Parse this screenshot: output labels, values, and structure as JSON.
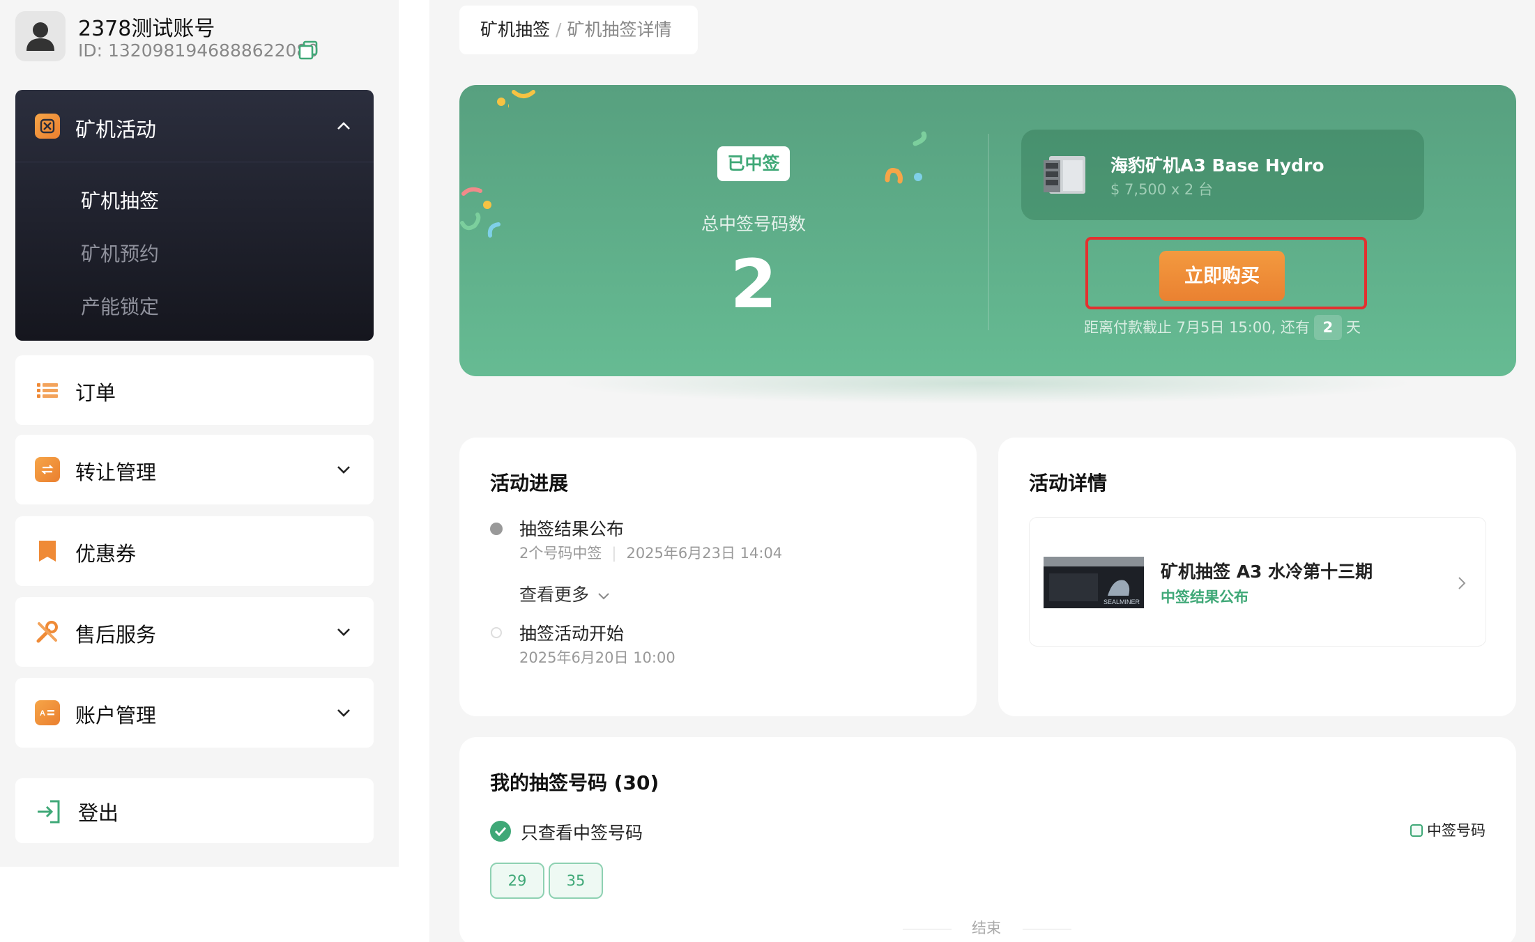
{
  "user": {
    "name": "2378测试账号",
    "id_text": "ID: 1320981946888622080"
  },
  "sidebar": {
    "groups": [
      {
        "label": "矿机活动",
        "expanded": true,
        "icon": "miner-activity-icon",
        "children": [
          {
            "label": "矿机抽签",
            "active": true
          },
          {
            "label": "矿机预约",
            "active": false
          },
          {
            "label": "产能锁定",
            "active": false
          }
        ]
      },
      {
        "label": "订单",
        "icon": "list-icon"
      },
      {
        "label": "转让管理",
        "icon": "transfer-icon"
      },
      {
        "label": "优惠券",
        "icon": "bookmark-icon"
      },
      {
        "label": "售后服务",
        "icon": "wrench-icon"
      },
      {
        "label": "账户管理",
        "icon": "id-card-icon"
      }
    ],
    "logout_label": "登出"
  },
  "breadcrumb": {
    "root": "矿机抽签",
    "separator": "/",
    "current": "矿机抽签详情"
  },
  "hero": {
    "badge": "已中签",
    "count_label": "总中签号码数",
    "count": "2",
    "product": {
      "name": "海豹矿机A3 Base Hydro",
      "price": "$ 7,500 x 2 台"
    },
    "buy_label": "立即购买",
    "deadline_prefix": "距离付款截止 7月5日 15:00, 还有",
    "days_left": "2",
    "days_unit": "天"
  },
  "progress": {
    "title": "活动进展",
    "events": [
      {
        "title": "抽签结果公布",
        "detail": "2个号码中签",
        "time": "2025年6月23日 14:04"
      },
      {
        "title": "抽签活动开始",
        "time": "2025年6月20日 10:00"
      }
    ],
    "see_more": "查看更多"
  },
  "detail": {
    "title": "活动详情",
    "event_title": "矿机抽签 A3 水冷第十三期",
    "event_status": "中签结果公布",
    "thumb_brand": "SEALMINER"
  },
  "numbers": {
    "title": "我的抽签号码 (30)",
    "filter_label": "只查看中签号码",
    "legend_label": "中签号码",
    "chips": [
      "29",
      "35"
    ],
    "end_text": "结束"
  },
  "colors": {
    "brand_green": "#3fa877",
    "hero_green": "#5ea886",
    "buy_orange": "#ee8b36",
    "highlight_red": "#e3302f",
    "sidebar_dark": "#1f212c"
  }
}
